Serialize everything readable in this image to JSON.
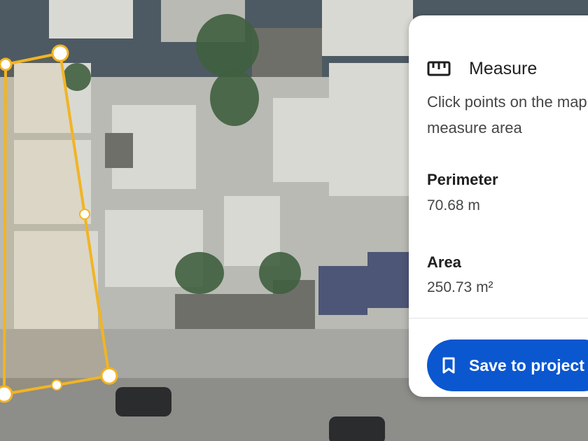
{
  "panel": {
    "icon": "ruler-icon",
    "title": "Measure",
    "hint": "Click points on the map to measure area",
    "perimeter": {
      "label": "Perimeter",
      "value": "70.68 m"
    },
    "area": {
      "label": "Area",
      "value": "250.73 m²"
    },
    "save_button": {
      "icon": "bookmark-icon",
      "label": "Save to project"
    }
  },
  "colors": {
    "measure_line": "#f2b424",
    "button_blue": "#0b57d0",
    "panel_bg": "#ffffff"
  }
}
